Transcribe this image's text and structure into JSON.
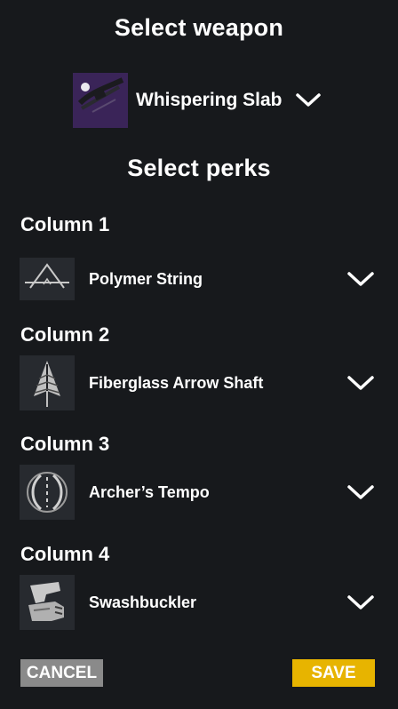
{
  "header": {
    "title": "Select weapon"
  },
  "weapon": {
    "name": "Whispering Slab",
    "icon": "bow-weapon-icon"
  },
  "perks_header": {
    "title": "Select perks"
  },
  "columns": [
    {
      "label": "Column 1",
      "perk": "Polymer String",
      "icon": "polymer-string-icon"
    },
    {
      "label": "Column 2",
      "perk": "Fiberglass Arrow Shaft",
      "icon": "arrow-shaft-icon"
    },
    {
      "label": "Column 3",
      "perk": "Archer’s Tempo",
      "icon": "archers-tempo-icon"
    },
    {
      "label": "Column 4",
      "perk": "Swashbuckler",
      "icon": "swashbuckler-icon"
    }
  ],
  "actions": {
    "cancel": "CANCEL",
    "save": "SAVE"
  },
  "colors": {
    "background": "#17191c",
    "save": "#e7b400",
    "cancel": "#8a8a8a",
    "weapon_icon_bg": "#3a2458"
  }
}
